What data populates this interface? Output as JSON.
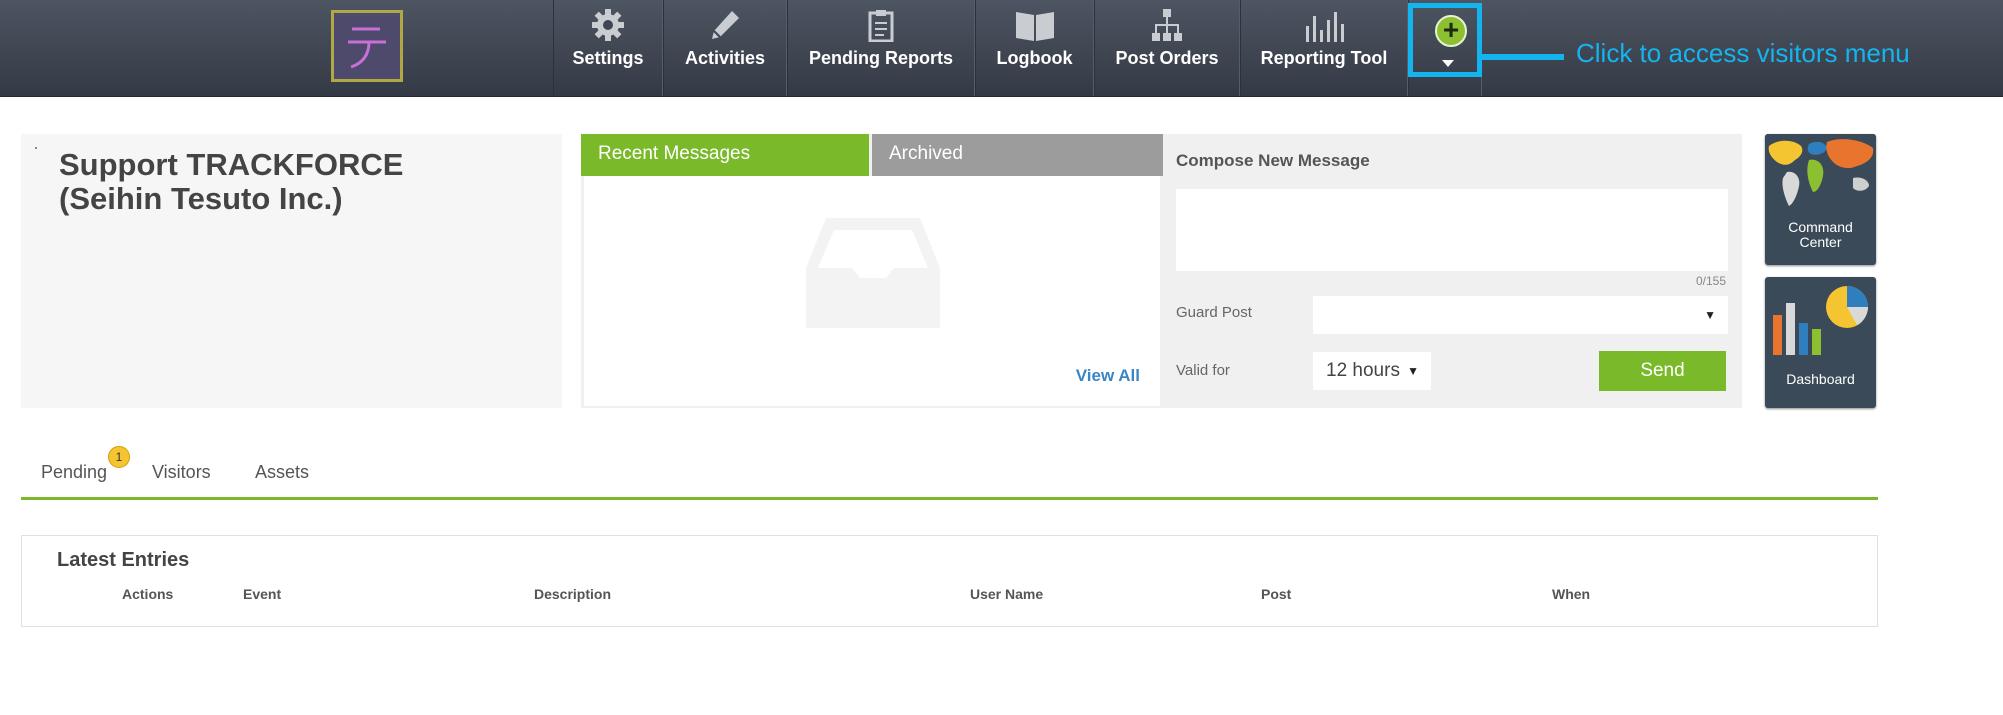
{
  "nav": {
    "items": [
      {
        "label": "Settings",
        "icon": "gear-icon"
      },
      {
        "label": "Activities",
        "icon": "pencil-icon"
      },
      {
        "label": "Pending Reports",
        "icon": "clipboard-icon"
      },
      {
        "label": "Logbook",
        "icon": "book-icon"
      },
      {
        "label": "Post Orders",
        "icon": "org-chart-icon"
      },
      {
        "label": "Reporting Tool",
        "icon": "bar-chart-icon"
      }
    ],
    "plus_symbol": "+",
    "callout": "Click to access visitors menu"
  },
  "org": {
    "name_line1": "Support TRACKFORCE",
    "name_line2": "(Seihin Tesuto Inc.)"
  },
  "messages": {
    "tab_recent": "Recent Messages",
    "tab_archived": "Archived",
    "view_all": "View All"
  },
  "compose": {
    "title": "Compose New Message",
    "message_value": "",
    "counter": "0/155",
    "guard_post_label": "Guard Post",
    "guard_post_value": "",
    "valid_for_label": "Valid for",
    "valid_for_value": "12 hours",
    "send_label": "Send"
  },
  "tiles": {
    "command_center_line1": "Command",
    "command_center_line2": "Center",
    "dashboard": "Dashboard"
  },
  "tabs": {
    "pending": "Pending",
    "pending_count": "1",
    "visitors": "Visitors",
    "assets": "Assets"
  },
  "entries": {
    "title": "Latest Entries",
    "columns": [
      "Actions",
      "Event",
      "Description",
      "User Name",
      "Post",
      "When"
    ]
  },
  "colors": {
    "accent_green": "#7aba2a",
    "highlight_blue": "#14b4ef",
    "link_blue": "#3a85c6",
    "topbar": "#3f4652"
  }
}
